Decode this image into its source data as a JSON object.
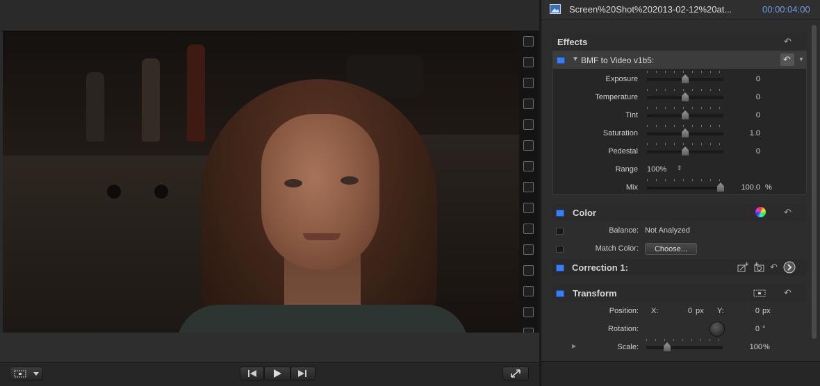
{
  "viewer": {
    "transport": {
      "prev_label": "Go to previous edit",
      "play_label": "Play",
      "next_label": "Go to next edit"
    }
  },
  "inspector": {
    "clip_name": "Screen%20Shot%202013-02-12%20at...",
    "timecode": "00:00:04:00",
    "effects": {
      "title": "Effects",
      "effect_name": "BMF to Video v1b5:",
      "params": [
        {
          "label": "Exposure",
          "value": "0",
          "slider": 0.5
        },
        {
          "label": "Temperature",
          "value": "0",
          "slider": 0.5
        },
        {
          "label": "Tint",
          "value": "0",
          "slider": 0.5
        },
        {
          "label": "Saturation",
          "value": "1.0",
          "slider": 0.5
        },
        {
          "label": "Pedestal",
          "value": "0",
          "slider": 0.5
        }
      ],
      "range": {
        "label": "Range",
        "value": "100%"
      },
      "mix": {
        "label": "Mix",
        "value": "100.0",
        "unit": "%",
        "slider": 1.0
      }
    },
    "color": {
      "title": "Color",
      "balance_label": "Balance:",
      "balance_value": "Not Analyzed",
      "match_label": "Match Color:",
      "choose_label": "Choose...",
      "correction_label": "Correction 1:"
    },
    "transform": {
      "title": "Transform",
      "position_label": "Position:",
      "x_label": "X:",
      "x_value": "0",
      "x_unit": "px",
      "y_label": "Y:",
      "y_value": "0",
      "y_unit": "px",
      "rotation_label": "Rotation:",
      "rotation_value": "0",
      "rotation_unit": "°",
      "scale_label": "Scale:",
      "scale_value": "100",
      "scale_unit": "%",
      "scale_slider": 0.27
    }
  }
}
